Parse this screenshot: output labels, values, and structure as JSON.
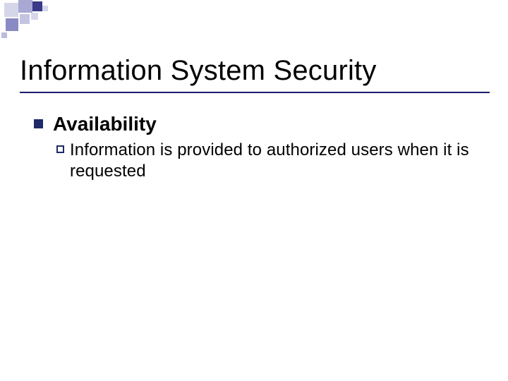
{
  "slide": {
    "title": "Information System Security",
    "bullets": {
      "level1": {
        "text": "Availability"
      },
      "level2": {
        "text": "Information is provided to authorized users when it is requested"
      }
    }
  },
  "theme": {
    "accent": "#1f2a6a",
    "underline": "#1a1a6e"
  }
}
